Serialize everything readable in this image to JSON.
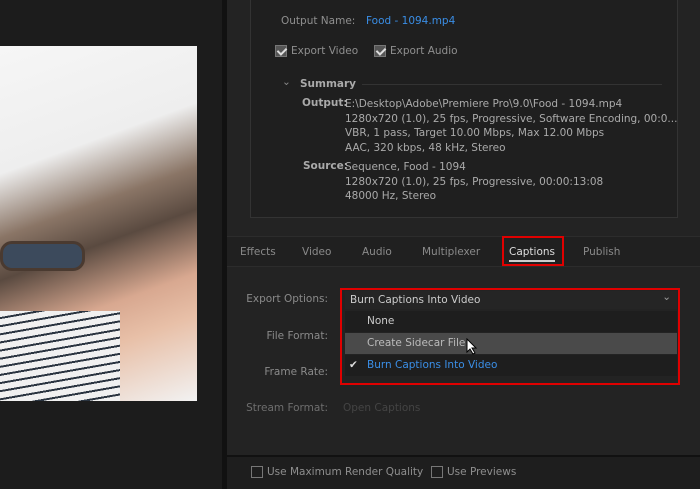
{
  "output": {
    "name_label": "Output Name:",
    "name_value": "Food - 1094.mp4",
    "export_video": {
      "label": "Export Video",
      "checked": true
    },
    "export_audio": {
      "label": "Export Audio",
      "checked": true
    }
  },
  "summary": {
    "title": "Summary",
    "output_label": "Output:",
    "output_lines": [
      "E:\\Desktop\\Adobe\\Premiere Pro\\9.0\\Food - 1094.mp4",
      "1280x720 (1.0), 25 fps, Progressive, Software Encoding, 00:0...",
      "VBR, 1 pass, Target 10.00 Mbps, Max 12.00 Mbps",
      "AAC, 320 kbps, 48 kHz, Stereo"
    ],
    "source_label": "Source:",
    "source_lines": [
      "Sequence, Food - 1094",
      "1280x720 (1.0), 25 fps, Progressive, 00:00:13:08",
      "48000 Hz, Stereo"
    ]
  },
  "tabs": [
    "Effects",
    "Video",
    "Audio",
    "Multiplexer",
    "Captions",
    "Publish"
  ],
  "active_tab": "Captions",
  "captions": {
    "export_options_label": "Export Options:",
    "export_options_value": "Burn Captions Into Video",
    "options": [
      "None",
      "Create Sidecar File",
      "Burn Captions Into Video"
    ],
    "hovered_option": "Create Sidecar File",
    "file_format_label": "File Format:",
    "frame_rate_label": "Frame Rate:",
    "stream_format_label": "Stream Format:",
    "stream_format_value": "Open Captions"
  },
  "bottom": {
    "max_render_quality": {
      "label": "Use Maximum Render Quality",
      "checked": false
    },
    "use_previews": {
      "label": "Use Previews",
      "checked": false
    }
  },
  "colors": {
    "highlight": "#e00000",
    "accent": "#3a8ee6"
  }
}
